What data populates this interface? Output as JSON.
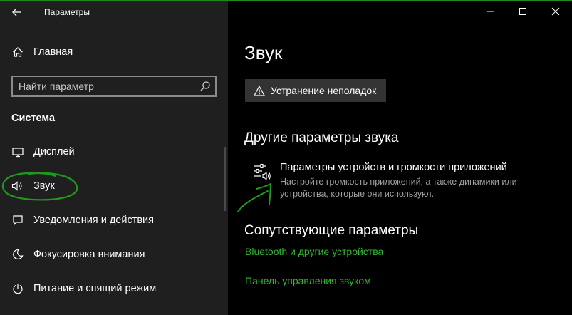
{
  "window": {
    "title": "Параметры",
    "controls": [
      "minimize-icon",
      "maximize-icon",
      "close-icon"
    ]
  },
  "sidebar": {
    "home": "Главная",
    "search_placeholder": "Найти параметр",
    "section": "Система",
    "items": [
      {
        "label": "Дисплей",
        "icon": "monitor-icon"
      },
      {
        "label": "Звук",
        "icon": "speaker-icon"
      },
      {
        "label": "Уведомления и действия",
        "icon": "notification-icon"
      },
      {
        "label": "Фокусировка внимания",
        "icon": "moon-icon"
      },
      {
        "label": "Питание и спящий режим",
        "icon": "power-icon"
      }
    ]
  },
  "main": {
    "title": "Звук",
    "troubleshoot_label": "Устранение неполадок",
    "other_heading": "Другие параметры звука",
    "device_settings": {
      "title": "Параметры устройств и громкости приложений",
      "description": "Настройте громкость приложений, а также динамики или устройства, которые они используют."
    },
    "related_heading": "Сопутствующие параметры",
    "links": [
      "Bluetooth и другие устройства",
      "Панель управления звуком"
    ]
  },
  "colors": {
    "sidebar_bg": "#1f1f1f",
    "main_bg": "#000000",
    "link": "#33b533",
    "annotation": "#1f9a1f"
  }
}
